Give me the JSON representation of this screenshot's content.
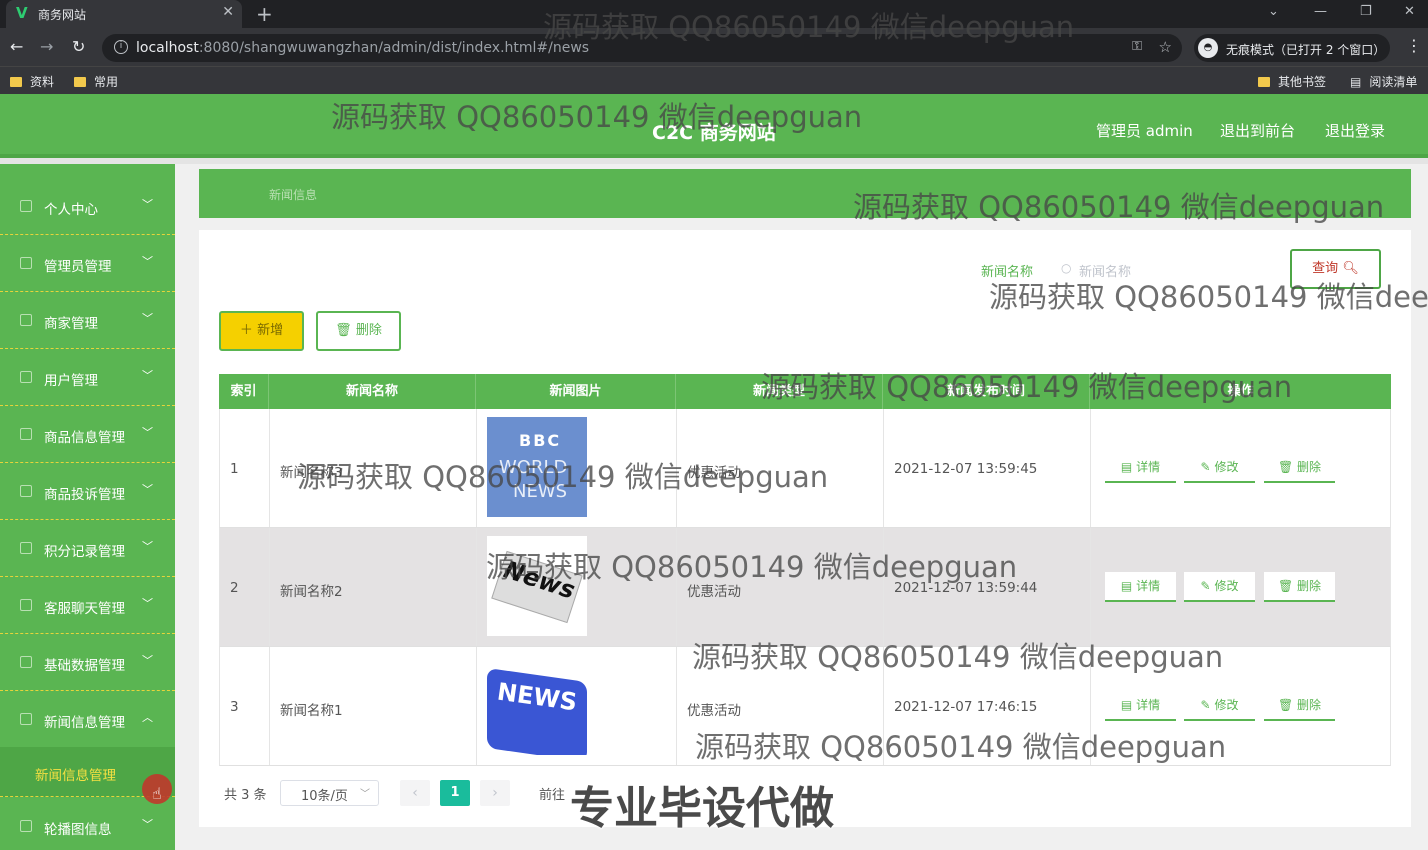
{
  "browser": {
    "tab_title": "商务网站",
    "url_host": "localhost",
    "url_rest": ":8080/shangwuwangzhan/admin/dist/index.html#/news",
    "incognito": "无痕模式（已打开 2 个窗口）",
    "bookmarks": [
      "资料",
      "常用"
    ],
    "bookmarks_right": [
      "其他书签",
      "阅读清单"
    ]
  },
  "header": {
    "brand": "C2C 商务网站",
    "admin": "管理员 admin",
    "to_front": "退出到前台",
    "logout": "退出登录"
  },
  "sidebar": {
    "items": [
      {
        "label": "个人中心",
        "icon": "user-icon"
      },
      {
        "label": "管理员管理",
        "icon": "list-icon"
      },
      {
        "label": "商家管理",
        "icon": "store-icon"
      },
      {
        "label": "用户管理",
        "icon": "users-icon"
      },
      {
        "label": "商品信息管理",
        "icon": "grid-icon"
      },
      {
        "label": "商品投诉管理",
        "icon": "complaint-icon"
      },
      {
        "label": "积分记录管理",
        "icon": "points-icon"
      },
      {
        "label": "客服聊天管理",
        "icon": "chat-icon"
      },
      {
        "label": "基础数据管理",
        "icon": "data-icon"
      },
      {
        "label": "新闻信息管理",
        "icon": "news-icon"
      },
      {
        "label": "轮播图信息",
        "icon": "image-icon"
      }
    ],
    "sub_active": "新闻信息管理"
  },
  "breadcrumb": "新闻信息",
  "search": {
    "label": "新闻名称",
    "placeholder": "新闻名称",
    "query_label": "查询"
  },
  "toolbar": {
    "add_label": "新增",
    "delete_label": "删除"
  },
  "table": {
    "headers": [
      "索引",
      "新闻名称",
      "新闻图片",
      "新闻类型",
      "新闻发布时间",
      "操作"
    ],
    "rows": [
      {
        "index": "1",
        "name": "新闻名称3",
        "type": "优惠活动",
        "time": "2021-12-07 13:59:45"
      },
      {
        "index": "2",
        "name": "新闻名称2",
        "type": "优惠活动",
        "time": "2021-12-07 13:59:44"
      },
      {
        "index": "3",
        "name": "新闻名称1",
        "type": "优惠活动",
        "time": "2021-12-07 17:46:15"
      }
    ],
    "actions": {
      "detail": "详情",
      "edit": "修改",
      "delete": "删除"
    },
    "thumb_text": {
      "bbc_1": "BBC",
      "bbc_2": "WORLD",
      "bbc_3": "NEWS",
      "news_paper": "News",
      "news_key": "NEWS"
    }
  },
  "pagination": {
    "total": "共 3 条",
    "page_size": "10条/页",
    "current": "1",
    "goto": "前往"
  },
  "watermark": {
    "text": "源码获取 QQ86050149 微信deepguan",
    "big": "专业毕设代做"
  },
  "colors": {
    "primary": "#5ab552",
    "accent_yellow": "#f5d000",
    "page_active": "#1abc9c"
  }
}
